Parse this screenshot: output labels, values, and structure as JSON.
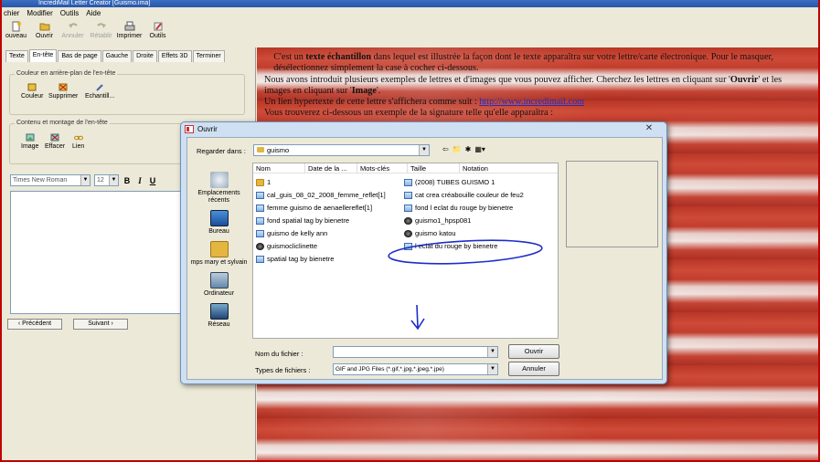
{
  "window": {
    "title": "IncrediMail Letter Creator [Guismo.ima]"
  },
  "menu": [
    "chier",
    "Modifier",
    "Outils",
    "Aide"
  ],
  "toolbar": {
    "items": [
      {
        "label": "ouveau",
        "icon": "new-document-icon",
        "enabled": true
      },
      {
        "label": "Ouvrir",
        "icon": "open-folder-icon",
        "enabled": true
      },
      {
        "label": "Annuler",
        "icon": "undo-icon",
        "enabled": false
      },
      {
        "label": "Rétablir",
        "icon": "redo-icon",
        "enabled": false
      },
      {
        "label": "Imprimer",
        "icon": "printer-icon",
        "enabled": true
      },
      {
        "label": "Outils",
        "icon": "tools-icon",
        "enabled": true
      }
    ]
  },
  "left_panel": {
    "tabs": [
      "Texte",
      "En-tête",
      "Bas de page",
      "Gauche",
      "Droite",
      "Effets 3D",
      "Terminer"
    ],
    "active_tab": "En-tête",
    "group1": {
      "label": "Couleur en arrière-plan de l'en-tête",
      "buttons": [
        "Couleur",
        "Supprimer",
        "Echantill..."
      ]
    },
    "group2": {
      "label": "Contenu et montage de l'en-tête",
      "buttons": [
        "Image",
        "Effacer",
        "Lien"
      ]
    },
    "font": {
      "family": "Times New Roman",
      "size": "12",
      "bold": "B",
      "italic": "I",
      "underline": "U"
    },
    "nav": {
      "prev": "‹ Précédent",
      "next": "Suivant ›"
    }
  },
  "right_panel": {
    "line1_pre": "C'est un ",
    "line1_bold": "texte échantillon",
    "line1_post": " dans lequel est illustrée la façon dont le texte apparaîtra sur votre lettre/carte électronique. Pour le masquer,",
    "line2": "désélectionnez simplement la case à cocher ci-dessous.",
    "line3_pre": "Nous avons introduit plusieurs exemples de lettres et d'images que vous pouvez afficher. Cherchez les lettres en cliquant sur '",
    "line3_bold": "Ouvrir",
    "line3_post": "' et les",
    "line4_pre": "images en cliquant sur '",
    "line4_bold": "Image",
    "line4_post": "'.",
    "line5_pre": "Un lien hypertexte de cette lettre s'affichera comme suit : ",
    "link": "http://www.incredimail.com",
    "line6": "Vous trouverez ci-dessous un exemple de la signature telle qu'elle apparaîtra :"
  },
  "dialog": {
    "title": "Ouvrir",
    "close": "✕",
    "look_in_label": "Regarder dans :",
    "look_in_value": "guismo",
    "places": [
      "Emplacements récents",
      "Bureau",
      "mps mary et sylvain",
      "Ordinateur",
      "Réseau"
    ],
    "columns": [
      "Nom",
      "Date de la ...",
      "Mots-clés",
      "Taille",
      "Notation"
    ],
    "files_col1": [
      {
        "name": "1",
        "type": "folder"
      },
      {
        "name": "cal_guis_08_02_2008_femme_reflet[1]",
        "type": "image"
      },
      {
        "name": "femme guismo de aenaellereflet[1]",
        "type": "image"
      },
      {
        "name": "fond spatial tag by bienetre",
        "type": "image"
      },
      {
        "name": "guismo de kelly ann",
        "type": "image"
      },
      {
        "name": "guismocliclinette",
        "type": "black"
      },
      {
        "name": "spatial tag by bienetre",
        "type": "image"
      }
    ],
    "files_col2": [
      {
        "name": "(2008) TUBES GUISMO 1",
        "type": "image"
      },
      {
        "name": "cat crea créabouille couleur de feu2",
        "type": "image"
      },
      {
        "name": "fond l eclat du rouge by bienetre",
        "type": "image"
      },
      {
        "name": "guismo1_hpsp081",
        "type": "black"
      },
      {
        "name": "guismo katou",
        "type": "black"
      },
      {
        "name": "l eclat du rouge by bienetre",
        "type": "image"
      }
    ],
    "filename_label": "Nom du fichier :",
    "filename_value": "",
    "filetype_label": "Types de fichiers :",
    "filetype_value": "GIF and JPG Files (*.gif,*.jpg,*.jpeg,*.jpe)",
    "open_button": "Ouvrir",
    "cancel_button": "Annuler",
    "annotation_color": "#1d2ec9"
  }
}
